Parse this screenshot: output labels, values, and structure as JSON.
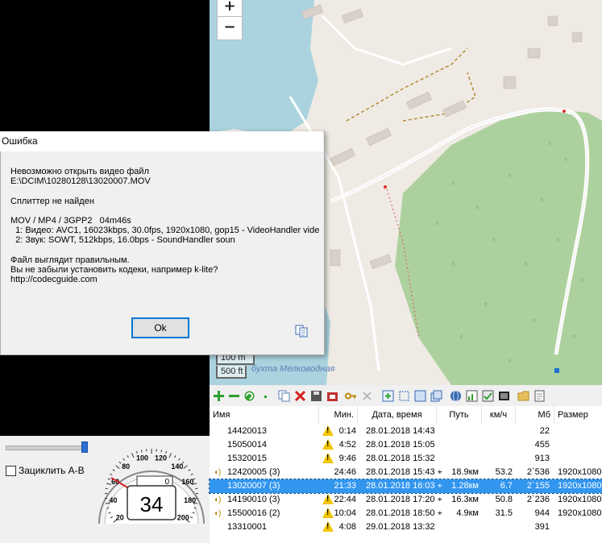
{
  "map": {
    "zoom_in": "+",
    "zoom_out": "−",
    "scale_metric": "100 m",
    "scale_imperial": "500 ft",
    "place_label": "бухта Мелководная"
  },
  "player": {
    "loop_label": "Зациклить А-В",
    "speed_value": "34",
    "odometer": "0",
    "dial_labels": [
      "20",
      "40",
      "60",
      "80",
      "100",
      "120",
      "140",
      "160",
      "180",
      "200"
    ]
  },
  "toolbar": {
    "icons": [
      "add-icon",
      "remove-icon",
      "refresh-icon",
      "dot-icon",
      "copy-icon",
      "delete-icon",
      "save-icon",
      "export-icon",
      "key-icon",
      "cut-icon",
      "add-frame-icon",
      "crop-icon",
      "select-icon",
      "layers-icon",
      "globe-icon",
      "chart-icon",
      "check-icon",
      "film-icon",
      "folder-icon",
      "document-icon"
    ]
  },
  "table": {
    "columns": [
      "Имя",
      "Мин.",
      "Дата, время",
      "Путь",
      "км/ч",
      "Мб",
      "Размер"
    ],
    "rows": [
      {
        "name": "14420013",
        "icon": "none",
        "warn": true,
        "min": "0:14",
        "datetime": "28.01.2018 14:43",
        "path": "",
        "speed": "",
        "mb": "22",
        "size": "",
        "selected": false
      },
      {
        "name": "15050014",
        "icon": "none",
        "warn": true,
        "min": "4:52",
        "datetime": "28.01.2018 15:05",
        "path": "",
        "speed": "",
        "mb": "455",
        "size": "",
        "selected": false
      },
      {
        "name": "15320015",
        "icon": "none",
        "warn": true,
        "min": "9:46",
        "datetime": "28.01.2018 15:32",
        "path": "",
        "speed": "",
        "mb": "913",
        "size": "",
        "selected": false
      },
      {
        "name": "12420005 (3)",
        "icon": "speaker",
        "warn": false,
        "min": "24:46",
        "datetime": "28.01.2018 15:43",
        "path": "18.9км",
        "speed": "53.2",
        "mb": "2`536",
        "size": "1920x1080",
        "selected": false
      },
      {
        "name": "13020007 (3)",
        "icon": "none",
        "warn": false,
        "min": "21:33",
        "datetime": "28.01.2018 16:03",
        "path": "1.28км",
        "speed": "6.7",
        "mb": "2`155",
        "size": "1920x1080",
        "selected": true
      },
      {
        "name": "14190010 (3)",
        "icon": "speaker",
        "warn": true,
        "min": "22:44",
        "datetime": "28.01.2018 17:20",
        "path": "16.3км",
        "speed": "50.8",
        "mb": "2`236",
        "size": "1920x1080",
        "selected": false
      },
      {
        "name": "15500016 (2)",
        "icon": "speaker",
        "warn": true,
        "min": "10:04",
        "datetime": "28.01.2018 18:50",
        "path": "4.9км",
        "speed": "31.5",
        "mb": "944",
        "size": "1920x1080",
        "selected": false
      },
      {
        "name": "13310001",
        "icon": "none",
        "warn": true,
        "min": "4:08",
        "datetime": "29.01.2018 13:32",
        "path": "",
        "speed": "",
        "mb": "391",
        "size": "",
        "selected": false
      }
    ]
  },
  "dialog": {
    "title": "Ошибка",
    "message": "Невозможно открыть видео файл\nE:\\DCIM\\10280128\\13020007.MOV\n\nСплиттер не найден\n\nMOV / MP4 / 3GPP2   04m46s\n  1: Видео: AVC1, 16023kbps, 30.0fps, 1920x1080, gop15 - VideoHandler vide\n  2: Звук: SOWT, 512kbps, 16.0bps - SoundHandler soun\n\nФайл выглядит правильным.\nВы не забыли установить кодеки, например k-lite?\nhttp://codecguide.com",
    "ok_label": "Ok"
  }
}
